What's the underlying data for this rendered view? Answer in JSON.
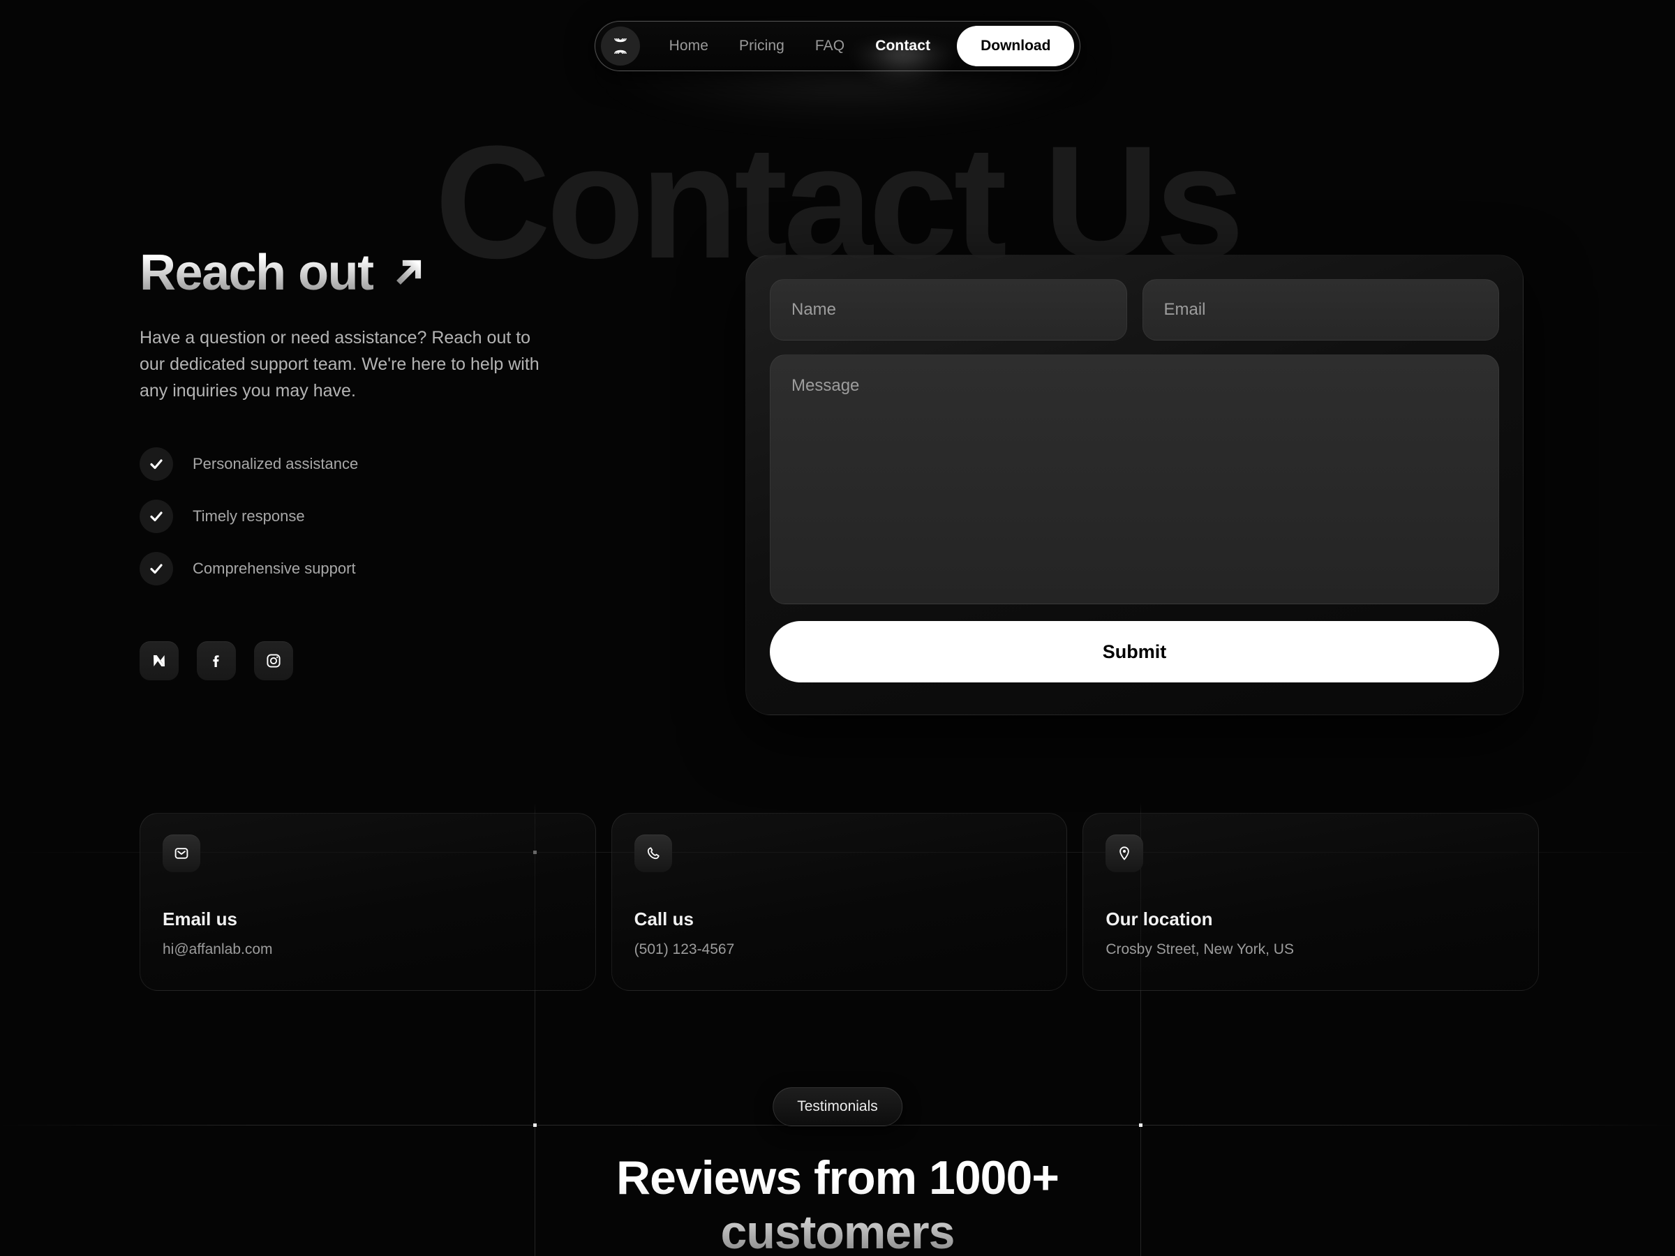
{
  "nav": {
    "logo_icon": "affanlab-logo-icon",
    "links": [
      {
        "label": "Home",
        "active": false
      },
      {
        "label": "Pricing",
        "active": false
      },
      {
        "label": "FAQ",
        "active": false
      },
      {
        "label": "Contact",
        "active": true
      }
    ],
    "cta_label": "Download"
  },
  "hero": {
    "ghost_title": "Contact Us",
    "title": "Reach out",
    "arrow_icon": "arrow-up-right-icon",
    "lead": "Have a question or need assistance? Reach out to our dedicated support team. We're here to help with any inquiries you may have.",
    "checklist": [
      {
        "label": "Personalized assistance",
        "icon": "check-icon"
      },
      {
        "label": "Timely response",
        "icon": "check-icon"
      },
      {
        "label": "Comprehensive support",
        "icon": "check-icon"
      }
    ],
    "socials": [
      {
        "name": "x-twitter-icon",
        "label": "X"
      },
      {
        "name": "facebook-icon",
        "label": "Facebook"
      },
      {
        "name": "instagram-icon",
        "label": "Instagram"
      }
    ]
  },
  "form": {
    "name_placeholder": "Name",
    "name_value": "",
    "email_placeholder": "Email",
    "email_value": "",
    "message_placeholder": "Message",
    "message_value": "",
    "submit_label": "Submit"
  },
  "info_cards": [
    {
      "icon": "mail-icon",
      "title": "Email us",
      "detail": "hi@affanlab.com"
    },
    {
      "icon": "phone-icon",
      "title": "Call us",
      "detail": "(501) 123-4567"
    },
    {
      "icon": "pin-icon",
      "title": "Our location",
      "detail": "Crosby Street, New York, US"
    }
  ],
  "testimonials": {
    "pill_label": "Testimonials",
    "heading_line1": "Reviews from 1000+",
    "heading_line2": "customers"
  },
  "colors": {
    "background": "#050505",
    "accent_white": "#ffffff",
    "muted_text": "#9c9c9c",
    "ghost_text": "#1b1b1b",
    "field_fill": "#2e2e2e"
  }
}
